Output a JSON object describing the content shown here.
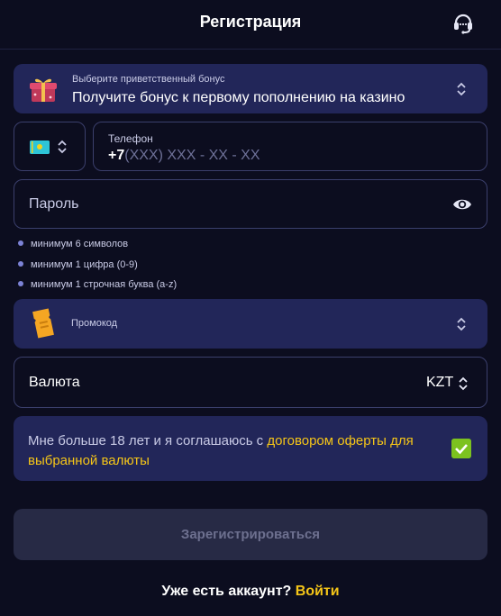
{
  "header": {
    "title": "Регистрация",
    "support_icon": "headset-icon"
  },
  "bonus": {
    "label": "Выберите приветственный бонус",
    "value": "Получите бонус к первому пополнению на казино",
    "icon": "gift-icon"
  },
  "country": {
    "flag": "kazakhstan-flag-icon"
  },
  "phone": {
    "label": "Телефон",
    "prefix": "+7",
    "mask": "(XXX) XXX - XX - XX"
  },
  "password": {
    "placeholder": "Пароль",
    "icon": "eye-icon"
  },
  "password_rules": [
    "минимум 6 символов",
    "минимум 1 цифра (0-9)",
    "минимум 1 строчная буква (a-z)"
  ],
  "promo": {
    "label": "Промокод",
    "icon": "ticket-icon"
  },
  "currency": {
    "label": "Валюта",
    "value": "KZT"
  },
  "agreement": {
    "text": "Мне больше 18 лет и я соглашаюсь с ",
    "link": "договором оферты для выбранной валюты",
    "checked": true
  },
  "register_button": "Зарегистрироваться",
  "login": {
    "question": "Уже есть аккаунт? ",
    "link": "Войти"
  },
  "colors": {
    "background": "#0c0d1f",
    "panel": "#222659",
    "accent": "#f5c518",
    "checkbox": "#7cc21f",
    "disabled_button": "#272a45"
  }
}
